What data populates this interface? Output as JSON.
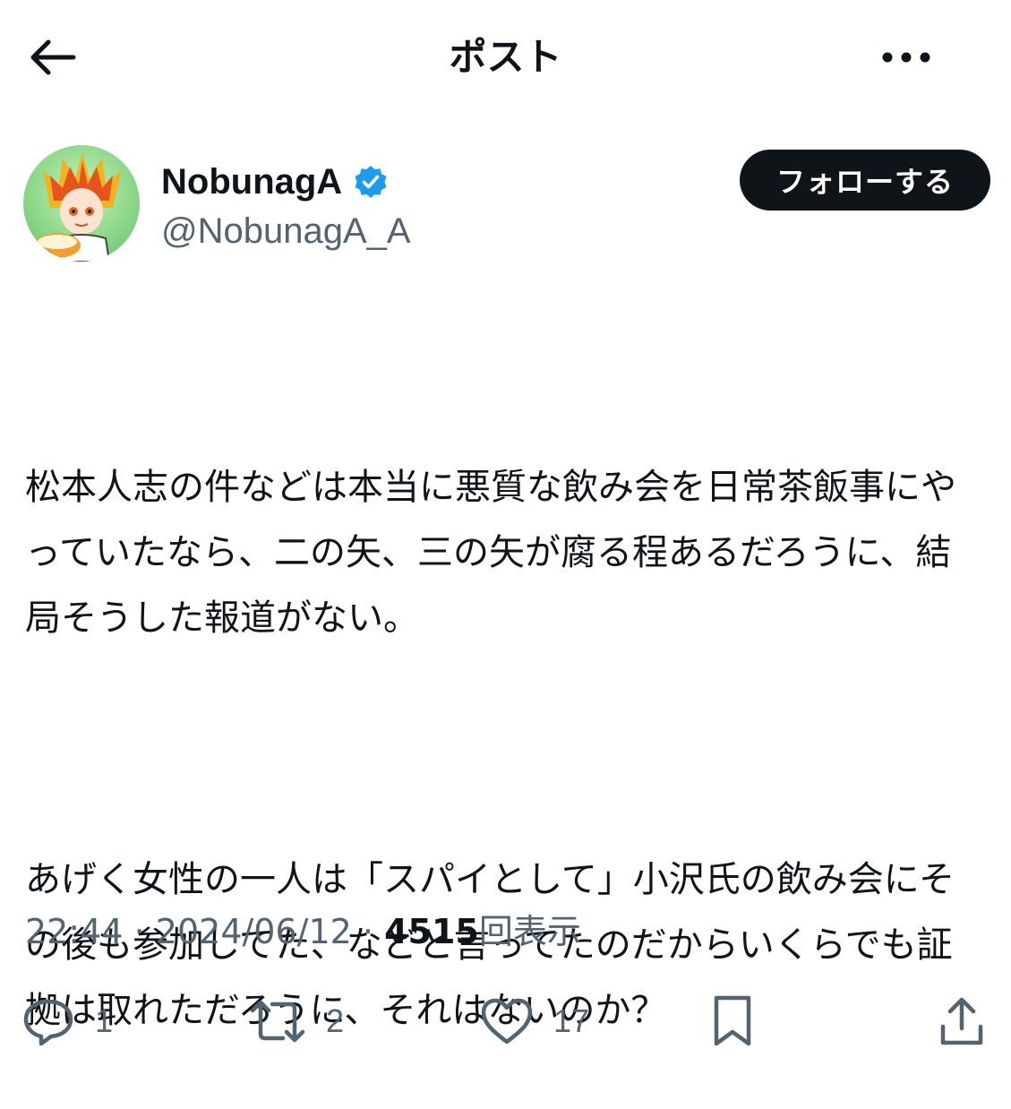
{
  "header": {
    "title": "ポスト"
  },
  "author": {
    "display_name": "NobunagA",
    "handle": "@NobunagA_A",
    "verified": true,
    "follow_label": "フォローする"
  },
  "post": {
    "paragraphs": [
      "松本人志の件などは本当に悪質な飲み会を日常茶飯事にやっていたなら、二の矢、三の矢が腐る程あるだろうに、結局そうした報道がない。",
      "あげく女性の一人は「スパイとして」小沢氏の飲み会にその後も参加してた、などと言ってたのだからいくらでも証拠は取れただろうに、それはないのか？"
    ]
  },
  "meta": {
    "time": "22:44",
    "separator": "·",
    "date": "2024/06/12",
    "views_count": "4515",
    "views_label": "回表示"
  },
  "actions": {
    "reply_count": "1",
    "repost_count": "2",
    "like_count": "17"
  },
  "colors": {
    "text": "#0f1419",
    "secondary": "#536471",
    "verified": "#1d9bf0",
    "follow_bg": "#0f1419"
  }
}
